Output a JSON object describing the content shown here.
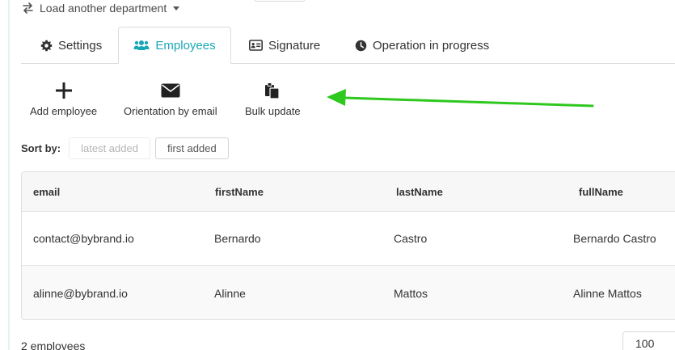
{
  "header": {
    "load_link_label": "Load another department"
  },
  "tabs": [
    {
      "label": "Settings",
      "icon": "gear-icon",
      "active": false
    },
    {
      "label": "Employees",
      "icon": "users-icon",
      "active": true
    },
    {
      "label": "Signature",
      "icon": "id-card-icon",
      "active": false
    },
    {
      "label": "Operation in progress",
      "icon": "clock-icon",
      "active": false
    }
  ],
  "actions": [
    {
      "label": "Add employee",
      "icon": "plus-icon"
    },
    {
      "label": "Orientation by email",
      "icon": "envelope-icon"
    },
    {
      "label": "Bulk update",
      "icon": "copy-files-icon"
    }
  ],
  "sort": {
    "label": "Sort by:",
    "options": [
      {
        "label": "latest added",
        "enabled": false
      },
      {
        "label": "first added",
        "enabled": true
      }
    ]
  },
  "table": {
    "columns": [
      "email",
      "firstName",
      "lastName",
      "fullName"
    ],
    "rows": [
      [
        "contact@bybrand.io",
        "Bernardo",
        "Castro",
        "Bernardo Castro"
      ],
      [
        "alinne@bybrand.io",
        "Alinne",
        "Mattos",
        "Alinne Mattos"
      ]
    ]
  },
  "footer": {
    "count": "2 employees",
    "page_size": "100"
  },
  "colors": {
    "accent": "#19a7b5",
    "annotation_arrow": "#2ec81e"
  }
}
